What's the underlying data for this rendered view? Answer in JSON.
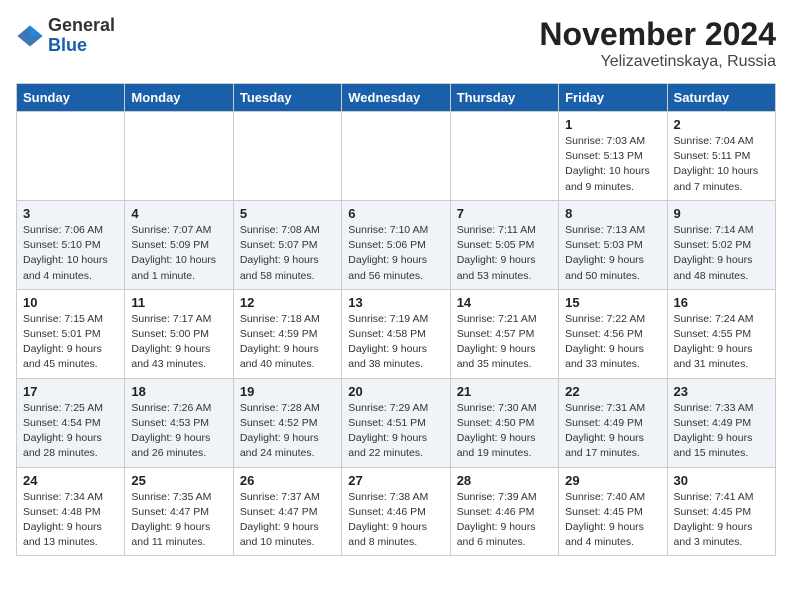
{
  "logo": {
    "general": "General",
    "blue": "Blue"
  },
  "title": "November 2024",
  "location": "Yelizavetinskaya, Russia",
  "days_of_week": [
    "Sunday",
    "Monday",
    "Tuesday",
    "Wednesday",
    "Thursday",
    "Friday",
    "Saturday"
  ],
  "weeks": [
    [
      {
        "day": "",
        "info": ""
      },
      {
        "day": "",
        "info": ""
      },
      {
        "day": "",
        "info": ""
      },
      {
        "day": "",
        "info": ""
      },
      {
        "day": "",
        "info": ""
      },
      {
        "day": "1",
        "info": "Sunrise: 7:03 AM\nSunset: 5:13 PM\nDaylight: 10 hours and 9 minutes."
      },
      {
        "day": "2",
        "info": "Sunrise: 7:04 AM\nSunset: 5:11 PM\nDaylight: 10 hours and 7 minutes."
      }
    ],
    [
      {
        "day": "3",
        "info": "Sunrise: 7:06 AM\nSunset: 5:10 PM\nDaylight: 10 hours and 4 minutes."
      },
      {
        "day": "4",
        "info": "Sunrise: 7:07 AM\nSunset: 5:09 PM\nDaylight: 10 hours and 1 minute."
      },
      {
        "day": "5",
        "info": "Sunrise: 7:08 AM\nSunset: 5:07 PM\nDaylight: 9 hours and 58 minutes."
      },
      {
        "day": "6",
        "info": "Sunrise: 7:10 AM\nSunset: 5:06 PM\nDaylight: 9 hours and 56 minutes."
      },
      {
        "day": "7",
        "info": "Sunrise: 7:11 AM\nSunset: 5:05 PM\nDaylight: 9 hours and 53 minutes."
      },
      {
        "day": "8",
        "info": "Sunrise: 7:13 AM\nSunset: 5:03 PM\nDaylight: 9 hours and 50 minutes."
      },
      {
        "day": "9",
        "info": "Sunrise: 7:14 AM\nSunset: 5:02 PM\nDaylight: 9 hours and 48 minutes."
      }
    ],
    [
      {
        "day": "10",
        "info": "Sunrise: 7:15 AM\nSunset: 5:01 PM\nDaylight: 9 hours and 45 minutes."
      },
      {
        "day": "11",
        "info": "Sunrise: 7:17 AM\nSunset: 5:00 PM\nDaylight: 9 hours and 43 minutes."
      },
      {
        "day": "12",
        "info": "Sunrise: 7:18 AM\nSunset: 4:59 PM\nDaylight: 9 hours and 40 minutes."
      },
      {
        "day": "13",
        "info": "Sunrise: 7:19 AM\nSunset: 4:58 PM\nDaylight: 9 hours and 38 minutes."
      },
      {
        "day": "14",
        "info": "Sunrise: 7:21 AM\nSunset: 4:57 PM\nDaylight: 9 hours and 35 minutes."
      },
      {
        "day": "15",
        "info": "Sunrise: 7:22 AM\nSunset: 4:56 PM\nDaylight: 9 hours and 33 minutes."
      },
      {
        "day": "16",
        "info": "Sunrise: 7:24 AM\nSunset: 4:55 PM\nDaylight: 9 hours and 31 minutes."
      }
    ],
    [
      {
        "day": "17",
        "info": "Sunrise: 7:25 AM\nSunset: 4:54 PM\nDaylight: 9 hours and 28 minutes."
      },
      {
        "day": "18",
        "info": "Sunrise: 7:26 AM\nSunset: 4:53 PM\nDaylight: 9 hours and 26 minutes."
      },
      {
        "day": "19",
        "info": "Sunrise: 7:28 AM\nSunset: 4:52 PM\nDaylight: 9 hours and 24 minutes."
      },
      {
        "day": "20",
        "info": "Sunrise: 7:29 AM\nSunset: 4:51 PM\nDaylight: 9 hours and 22 minutes."
      },
      {
        "day": "21",
        "info": "Sunrise: 7:30 AM\nSunset: 4:50 PM\nDaylight: 9 hours and 19 minutes."
      },
      {
        "day": "22",
        "info": "Sunrise: 7:31 AM\nSunset: 4:49 PM\nDaylight: 9 hours and 17 minutes."
      },
      {
        "day": "23",
        "info": "Sunrise: 7:33 AM\nSunset: 4:49 PM\nDaylight: 9 hours and 15 minutes."
      }
    ],
    [
      {
        "day": "24",
        "info": "Sunrise: 7:34 AM\nSunset: 4:48 PM\nDaylight: 9 hours and 13 minutes."
      },
      {
        "day": "25",
        "info": "Sunrise: 7:35 AM\nSunset: 4:47 PM\nDaylight: 9 hours and 11 minutes."
      },
      {
        "day": "26",
        "info": "Sunrise: 7:37 AM\nSunset: 4:47 PM\nDaylight: 9 hours and 10 minutes."
      },
      {
        "day": "27",
        "info": "Sunrise: 7:38 AM\nSunset: 4:46 PM\nDaylight: 9 hours and 8 minutes."
      },
      {
        "day": "28",
        "info": "Sunrise: 7:39 AM\nSunset: 4:46 PM\nDaylight: 9 hours and 6 minutes."
      },
      {
        "day": "29",
        "info": "Sunrise: 7:40 AM\nSunset: 4:45 PM\nDaylight: 9 hours and 4 minutes."
      },
      {
        "day": "30",
        "info": "Sunrise: 7:41 AM\nSunset: 4:45 PM\nDaylight: 9 hours and 3 minutes."
      }
    ]
  ]
}
